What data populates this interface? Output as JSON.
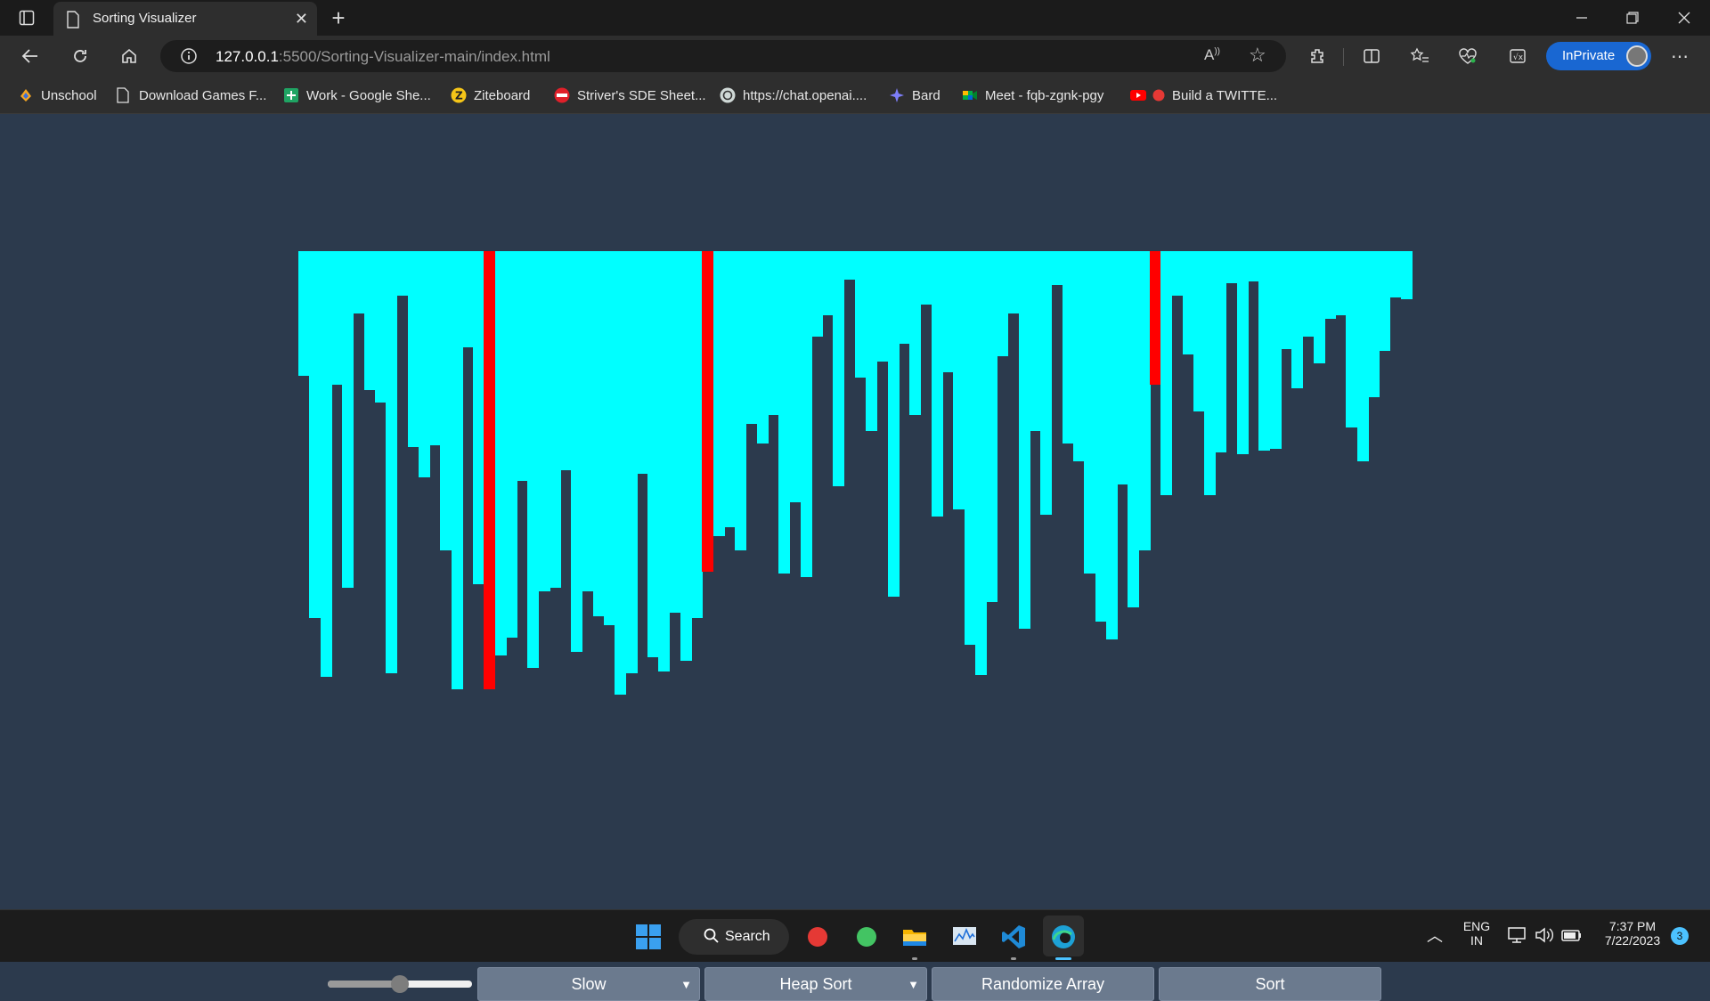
{
  "browser": {
    "tab_title": "Sorting Visualizer",
    "url_host": "127.0.0.1",
    "url_path": ":5500/Sorting-Visualizer-main/index.html",
    "profile_label": "InPrivate",
    "bookmarks": [
      {
        "label": "Unschool",
        "icon": "unschool-icon"
      },
      {
        "label": "Download Games F...",
        "icon": "page-icon"
      },
      {
        "label": "Work - Google She...",
        "icon": "sheets-icon"
      },
      {
        "label": "Ziteboard",
        "icon": "ziteboard-icon"
      },
      {
        "label": "Striver's SDE Sheet...",
        "icon": "tuf-icon"
      },
      {
        "label": "https://chat.openai....",
        "icon": "openai-icon"
      },
      {
        "label": "Bard",
        "icon": "bard-icon"
      },
      {
        "label": "Meet - fqb-zgnk-pgy",
        "icon": "meet-icon"
      },
      {
        "label": "Build a TWITTE...",
        "icon": "youtube-icon"
      }
    ]
  },
  "visualizer": {
    "bar_color": "#00ffff",
    "highlight_color": "#ff0000",
    "background": "#2c3a4d",
    "bars": [
      {
        "value": 140,
        "state": "normal"
      },
      {
        "value": 412,
        "state": "normal"
      },
      {
        "value": 478,
        "state": "normal"
      },
      {
        "value": 150,
        "state": "normal"
      },
      {
        "value": 378,
        "state": "normal"
      },
      {
        "value": 70,
        "state": "normal"
      },
      {
        "value": 156,
        "state": "normal"
      },
      {
        "value": 170,
        "state": "normal"
      },
      {
        "value": 474,
        "state": "normal"
      },
      {
        "value": 50,
        "state": "normal"
      },
      {
        "value": 220,
        "state": "normal"
      },
      {
        "value": 254,
        "state": "normal"
      },
      {
        "value": 218,
        "state": "normal"
      },
      {
        "value": 336,
        "state": "normal"
      },
      {
        "value": 492,
        "state": "normal"
      },
      {
        "value": 108,
        "state": "normal"
      },
      {
        "value": 374,
        "state": "normal"
      },
      {
        "value": 492,
        "state": "highlighted"
      },
      {
        "value": 454,
        "state": "normal"
      },
      {
        "value": 434,
        "state": "normal"
      },
      {
        "value": 258,
        "state": "normal"
      },
      {
        "value": 468,
        "state": "normal"
      },
      {
        "value": 382,
        "state": "normal"
      },
      {
        "value": 378,
        "state": "normal"
      },
      {
        "value": 246,
        "state": "normal"
      },
      {
        "value": 450,
        "state": "normal"
      },
      {
        "value": 382,
        "state": "normal"
      },
      {
        "value": 410,
        "state": "normal"
      },
      {
        "value": 420,
        "state": "normal"
      },
      {
        "value": 498,
        "state": "normal"
      },
      {
        "value": 474,
        "state": "normal"
      },
      {
        "value": 250,
        "state": "normal"
      },
      {
        "value": 456,
        "state": "normal"
      },
      {
        "value": 472,
        "state": "normal"
      },
      {
        "value": 406,
        "state": "normal"
      },
      {
        "value": 460,
        "state": "normal"
      },
      {
        "value": 412,
        "state": "normal"
      },
      {
        "value": 360,
        "state": "highlighted"
      },
      {
        "value": 320,
        "state": "normal"
      },
      {
        "value": 310,
        "state": "normal"
      },
      {
        "value": 336,
        "state": "normal"
      },
      {
        "value": 194,
        "state": "normal"
      },
      {
        "value": 216,
        "state": "normal"
      },
      {
        "value": 184,
        "state": "normal"
      },
      {
        "value": 362,
        "state": "normal"
      },
      {
        "value": 282,
        "state": "normal"
      },
      {
        "value": 366,
        "state": "normal"
      },
      {
        "value": 96,
        "state": "normal"
      },
      {
        "value": 72,
        "state": "normal"
      },
      {
        "value": 264,
        "state": "normal"
      },
      {
        "value": 32,
        "state": "normal"
      },
      {
        "value": 142,
        "state": "normal"
      },
      {
        "value": 202,
        "state": "normal"
      },
      {
        "value": 124,
        "state": "normal"
      },
      {
        "value": 388,
        "state": "normal"
      },
      {
        "value": 104,
        "state": "normal"
      },
      {
        "value": 184,
        "state": "normal"
      },
      {
        "value": 60,
        "state": "normal"
      },
      {
        "value": 298,
        "state": "normal"
      },
      {
        "value": 136,
        "state": "normal"
      },
      {
        "value": 290,
        "state": "normal"
      },
      {
        "value": 442,
        "state": "normal"
      },
      {
        "value": 476,
        "state": "normal"
      },
      {
        "value": 394,
        "state": "normal"
      },
      {
        "value": 118,
        "state": "normal"
      },
      {
        "value": 70,
        "state": "normal"
      },
      {
        "value": 424,
        "state": "normal"
      },
      {
        "value": 202,
        "state": "normal"
      },
      {
        "value": 296,
        "state": "normal"
      },
      {
        "value": 38,
        "state": "normal"
      },
      {
        "value": 216,
        "state": "normal"
      },
      {
        "value": 236,
        "state": "normal"
      },
      {
        "value": 362,
        "state": "normal"
      },
      {
        "value": 416,
        "state": "normal"
      },
      {
        "value": 436,
        "state": "normal"
      },
      {
        "value": 262,
        "state": "normal"
      },
      {
        "value": 400,
        "state": "normal"
      },
      {
        "value": 336,
        "state": "normal"
      },
      {
        "value": 150,
        "state": "highlighted"
      },
      {
        "value": 274,
        "state": "normal"
      },
      {
        "value": 50,
        "state": "normal"
      },
      {
        "value": 116,
        "state": "normal"
      },
      {
        "value": 180,
        "state": "normal"
      },
      {
        "value": 274,
        "state": "normal"
      },
      {
        "value": 226,
        "state": "normal"
      },
      {
        "value": 36,
        "state": "normal"
      },
      {
        "value": 228,
        "state": "normal"
      },
      {
        "value": 34,
        "state": "normal"
      },
      {
        "value": 224,
        "state": "normal"
      },
      {
        "value": 222,
        "state": "normal"
      },
      {
        "value": 110,
        "state": "normal"
      },
      {
        "value": 154,
        "state": "normal"
      },
      {
        "value": 96,
        "state": "normal"
      },
      {
        "value": 126,
        "state": "normal"
      },
      {
        "value": 76,
        "state": "normal"
      },
      {
        "value": 72,
        "state": "normal"
      },
      {
        "value": 198,
        "state": "normal"
      },
      {
        "value": 236,
        "state": "normal"
      },
      {
        "value": 164,
        "state": "normal"
      },
      {
        "value": 112,
        "state": "normal"
      },
      {
        "value": 52,
        "state": "normal"
      },
      {
        "value": 54,
        "state": "normal"
      }
    ]
  },
  "controls": {
    "speed_slider_level": 0.5,
    "speed_label": "Slow",
    "algorithm_label": "Heap Sort",
    "randomize_label": "Randomize Array",
    "sort_label": "Sort"
  },
  "taskbar": {
    "search_label": "Search",
    "language": "ENG",
    "region": "IN",
    "time": "7:37 PM",
    "date": "7/22/2023",
    "notification_count": "3"
  }
}
